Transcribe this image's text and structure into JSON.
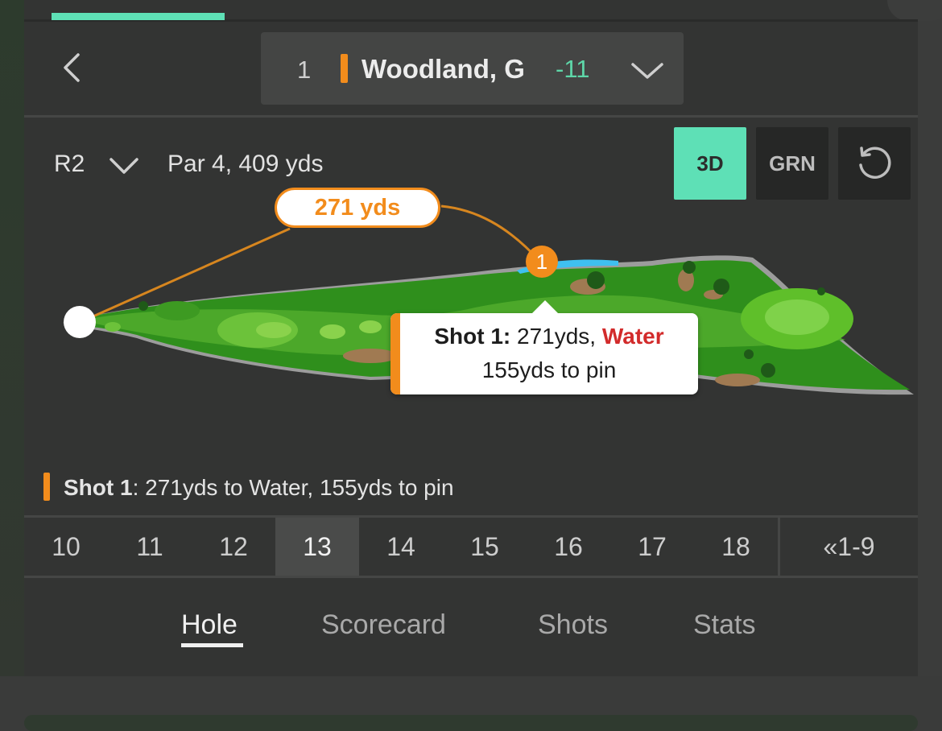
{
  "header": {
    "player": {
      "rank": "1",
      "name": "Woodland, G",
      "score": "-11"
    }
  },
  "hole_info": {
    "round": "R2",
    "par_yards": "Par 4, 409 yds"
  },
  "view_buttons": {
    "three_d": "3D",
    "green": "GRN",
    "reset_icon": "reset-icon"
  },
  "map": {
    "distance_label": "271 yds",
    "shot_marker": "1",
    "tooltip": {
      "shot_label": "Shot 1:",
      "distance": " 271yds, ",
      "result": "Water",
      "to_pin": "155yds to pin"
    }
  },
  "shot_summary": {
    "label": "Shot 1",
    "text": ": 271yds to Water, 155yds to pin"
  },
  "holes": [
    "10",
    "11",
    "12",
    "13",
    "14",
    "15",
    "16",
    "17",
    "18"
  ],
  "current_hole": "13",
  "front_nine_label": "«1-9",
  "tabs": [
    "Hole",
    "Scorecard",
    "Shots",
    "Stats"
  ],
  "colors": {
    "accent": "#5ee0b6",
    "shot": "#f28c1c",
    "water": "#d22b2b",
    "score": "#5ed6a8"
  }
}
